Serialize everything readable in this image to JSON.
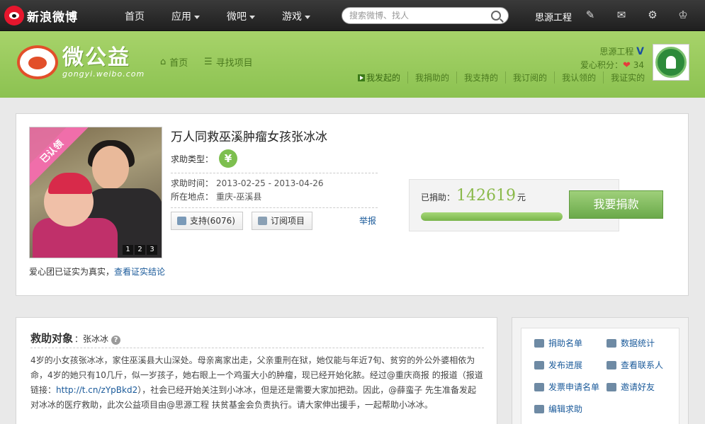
{
  "topnav": {
    "brand": "新浪微博",
    "items": [
      {
        "label": "首页"
      },
      {
        "label": "应用"
      },
      {
        "label": "微吧"
      },
      {
        "label": "游戏"
      }
    ],
    "search_placeholder": "搜索微博、找人",
    "username": "思源工程",
    "icons": [
      "edit-icon",
      "mail-icon",
      "gear-icon",
      "crown-icon"
    ]
  },
  "gongyi": {
    "logo_text": "微公益",
    "logo_sub": "gongyi.weibo.com",
    "nav_home": "首页",
    "nav_find": "寻找项目",
    "user_name": "思源工程",
    "vbadge": "V",
    "love_label": "爱心积分：",
    "love_score": "34",
    "tabs": [
      "我发起的",
      "我捐助的",
      "我支持的",
      "我订阅的",
      "我认领的",
      "我证实的"
    ]
  },
  "project": {
    "ribbon": "已认领",
    "pager": [
      "1",
      "2",
      "3"
    ],
    "title": "万人同救巫溪肿瘤女孩张冰冰",
    "type_label": "求助类型：",
    "type_icon": "¥",
    "time_label": "求助时间",
    "time_value": "2013-02-25 - 2013-04-26",
    "place_label": "所在地点",
    "place_value": "重庆-巫溪县",
    "support_btn": "支持(6076)",
    "subscribe_btn": "订阅项目",
    "report": "举报",
    "verified_text": "爱心团已证实为真实，",
    "verified_link": "查看证实结论",
    "raised_label": "已捐助：",
    "raised_amount": "142619",
    "raised_unit": "元",
    "donate_button": "我要捐款"
  },
  "description": {
    "heading": "救助对象",
    "name": "：张冰冰",
    "help_icon": "?",
    "p1": "4岁的小女孩张冰冰，家住巫溪县大山深处。母亲离家出走，父亲重刑在狱，她仅能与年近7旬、贫穷的外公外婆相依为命，4岁的她只有10几斤，似一岁孩子，她右眼上一个鸡蛋大小的肿瘤，现已经开始化脓。经过@重庆商报 的报道（报道链接：",
    "link": "http://t.cn/zYpBkd2",
    "p2": "），社会已经开始关注到小冰冰，但是还是需要大家加把劲。因此，@薛蛮子 先生准备发起对冰冰的医疗救助，此次公益项目由@思源工程 扶贫基金会负责执行。请大家伸出援手，一起帮助小冰冰。"
  },
  "sidebar": {
    "actions": [
      {
        "label": "捐助名单"
      },
      {
        "label": "数据统计"
      },
      {
        "label": "发布进展"
      },
      {
        "label": "查看联系人"
      },
      {
        "label": "发票申请名单"
      },
      {
        "label": "邀请好友"
      },
      {
        "label": "编辑求助"
      }
    ]
  }
}
